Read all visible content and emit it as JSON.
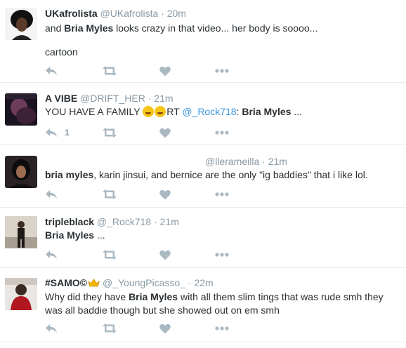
{
  "tweets": [
    {
      "name": "UKafrolista",
      "handle": "@UKafrolista",
      "time": "20m",
      "text_pre": "and ",
      "text_bold": "Bria Myles",
      "text_post": " looks crazy in that video... her body is soooo...",
      "text_line2": "cartoon"
    },
    {
      "name": "A VIBE",
      "handle": "@DRIFT_HER",
      "time": "21m",
      "text_pre": "YOU HAVE A FAMILY ",
      "text_rt": "RT ",
      "text_mention": "@_Rock718",
      "text_colon": ": ",
      "text_bold": "Bria Myles",
      "text_post": " ...",
      "reply_count": "1"
    },
    {
      "handle": "@llerameilla",
      "time": "21m",
      "text_bold": "bria myles",
      "text_post": ", karin jinsui, and bernice are the only \"ig baddies\" that i like lol."
    },
    {
      "name": "tripleblack",
      "handle": "@_Rock718",
      "time": "21m",
      "text_bold": "Bria Myles",
      "text_post": " ..."
    },
    {
      "name": "#SAMO©",
      "handle": "@_YoungPicasso_",
      "time": "22m",
      "text_pre": "Why did they have ",
      "text_bold": "Bria Myles",
      "text_post": " with all them slim tings that was rude smh they was all baddie though but she showed out on em smh"
    }
  ],
  "separator": "·",
  "icons": {
    "reply": "reply-icon",
    "retweet": "retweet-icon",
    "like": "heart-icon",
    "more": "more-dots-icon",
    "crown": "crown-icon"
  },
  "colors": {
    "icon": "#aab8c2",
    "muted": "#8899a6",
    "link": "#3b94d9",
    "text": "#292f33",
    "divider": "#e6ecf0"
  }
}
